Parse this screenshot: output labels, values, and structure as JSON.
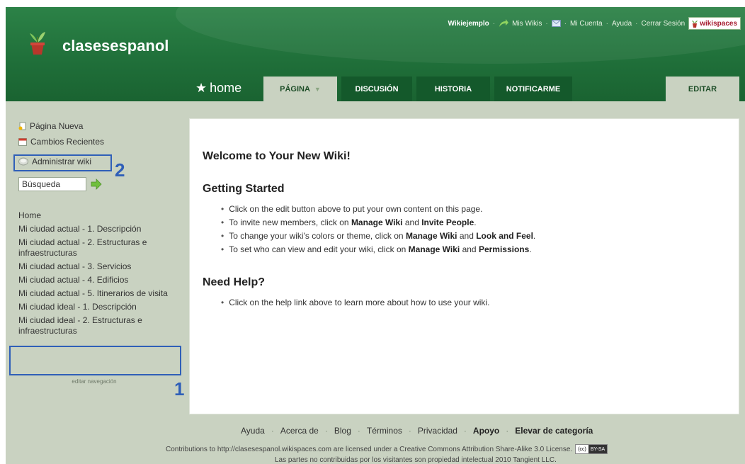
{
  "site": {
    "title": "clasesespanol"
  },
  "top_nav": {
    "wiki_name": "Wikiejemplo",
    "my_wikis": "Mis Wikis",
    "my_account": "Mi Cuenta",
    "help": "Ayuda",
    "logout": "Cerrar Sesión",
    "brand": "wikispaces",
    "separator": "·"
  },
  "tabs": {
    "home": "home",
    "page": "PÁGINA",
    "discussion": "DISCUSIÓN",
    "history": "HISTORIA",
    "notify": "NOTIFICARME",
    "edit": "EDITAR"
  },
  "sidebar": {
    "new_page": "Página Nueva",
    "recent_changes": "Cambios Recientes",
    "manage_wiki": "Administrar wiki",
    "search_value": "Búsqueda",
    "nav_items": [
      "Home",
      "Mi ciudad actual - 1. Descripción",
      "Mi ciudad actual - 2. Estructuras e infraestructuras",
      "Mi ciudad actual - 3. Servicios",
      "Mi ciudad actual - 4. Edificios",
      "Mi ciudad actual - 5. Itinerarios de visita",
      "Mi ciudad ideal - 1. Descripción",
      "Mi ciudad ideal - 2. Estructuras e infraestructuras"
    ],
    "edit_nav": "editar navegación"
  },
  "annotations": {
    "one": "1",
    "two": "2"
  },
  "content": {
    "welcome": "Welcome to Your New Wiki!",
    "getting_started": "Getting Started",
    "gs_items": [
      {
        "a": "Click on the edit button above to put your own content on this page."
      },
      {
        "a": "To invite new members, click on ",
        "b1": "Manage Wiki",
        "c": " and ",
        "b2": "Invite People",
        "d": "."
      },
      {
        "a": "To change your wiki's colors or theme, click on ",
        "b1": "Manage Wiki",
        "c": " and ",
        "b2": "Look and Feel",
        "d": "."
      },
      {
        "a": "To set who can view and edit your wiki, click on ",
        "b1": "Manage Wiki",
        "c": " and ",
        "b2": "Permissions",
        "d": "."
      }
    ],
    "need_help": "Need Help?",
    "help_items": [
      "Click on the help link above to learn more about how to use your wiki."
    ]
  },
  "footer": {
    "links": [
      "Ayuda",
      "Acerca de",
      "Blog",
      "Términos",
      "Privacidad",
      "Apoyo",
      "Elevar de categoría"
    ],
    "separator": "·",
    "license": "Contributions to http://clasesespanol.wikispaces.com are licensed under a Creative Commons Attribution Share-Alike 3.0 License.",
    "cc_left": "(cc)",
    "cc_right": "BY-SA",
    "license2": "Las partes no contribuidas por los visitantes son propiedad intelectual 2010 Tangient LLC."
  },
  "colors": {
    "header_green": "#20703a",
    "tab_dark": "#14592b",
    "page_bg": "#c9d2c1",
    "annotation_blue": "#2f5fb8"
  }
}
